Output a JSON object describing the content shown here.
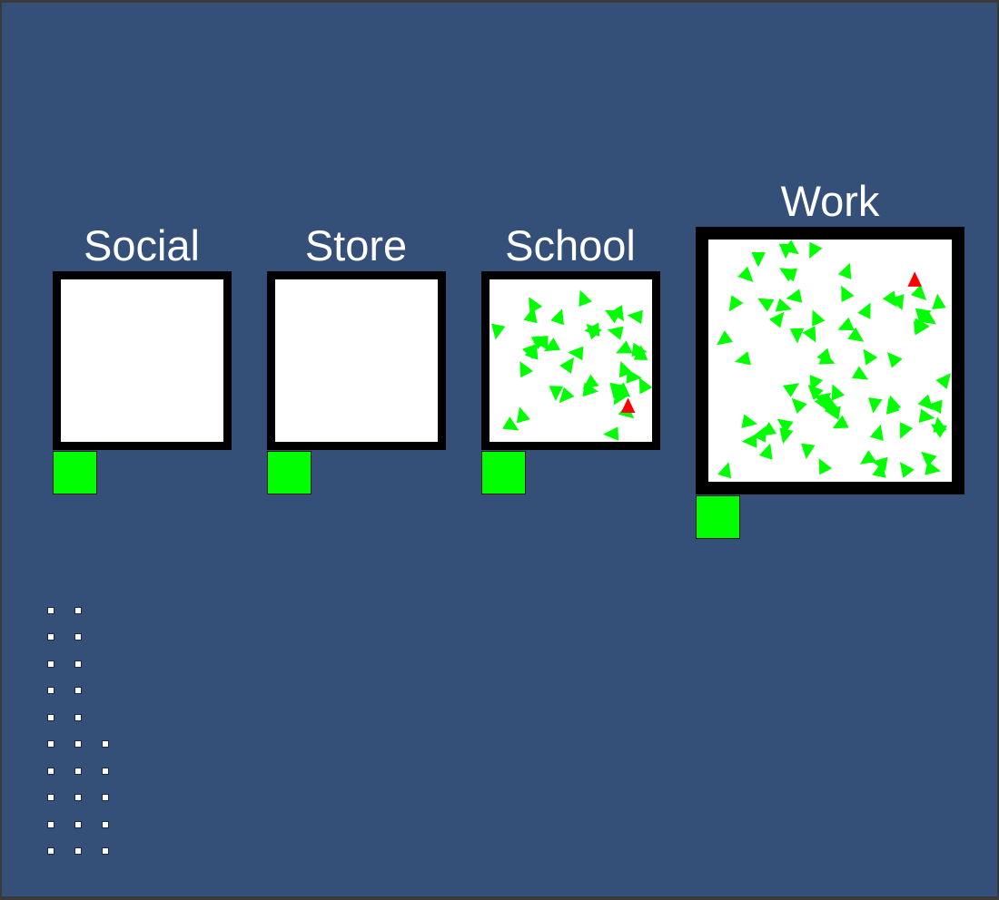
{
  "colors": {
    "background": "#344f78",
    "room_fill": "#ffffff",
    "room_wall": "#000000",
    "door": "#00ff00",
    "agent_healthy": "#00ff00",
    "agent_infected": "#ff0000",
    "label": "#ffffff"
  },
  "locations": [
    {
      "id": "social",
      "label": "Social",
      "healthy_agents": 0,
      "infected_agents": 0
    },
    {
      "id": "store",
      "label": "Store",
      "healthy_agents": 0,
      "infected_agents": 0
    },
    {
      "id": "school",
      "label": "School",
      "healthy_agents": 36,
      "infected_agents": 1
    },
    {
      "id": "work",
      "label": "Work",
      "healthy_agents": 72,
      "infected_agents": 1
    }
  ],
  "counter_columns": [
    10,
    10,
    5
  ]
}
